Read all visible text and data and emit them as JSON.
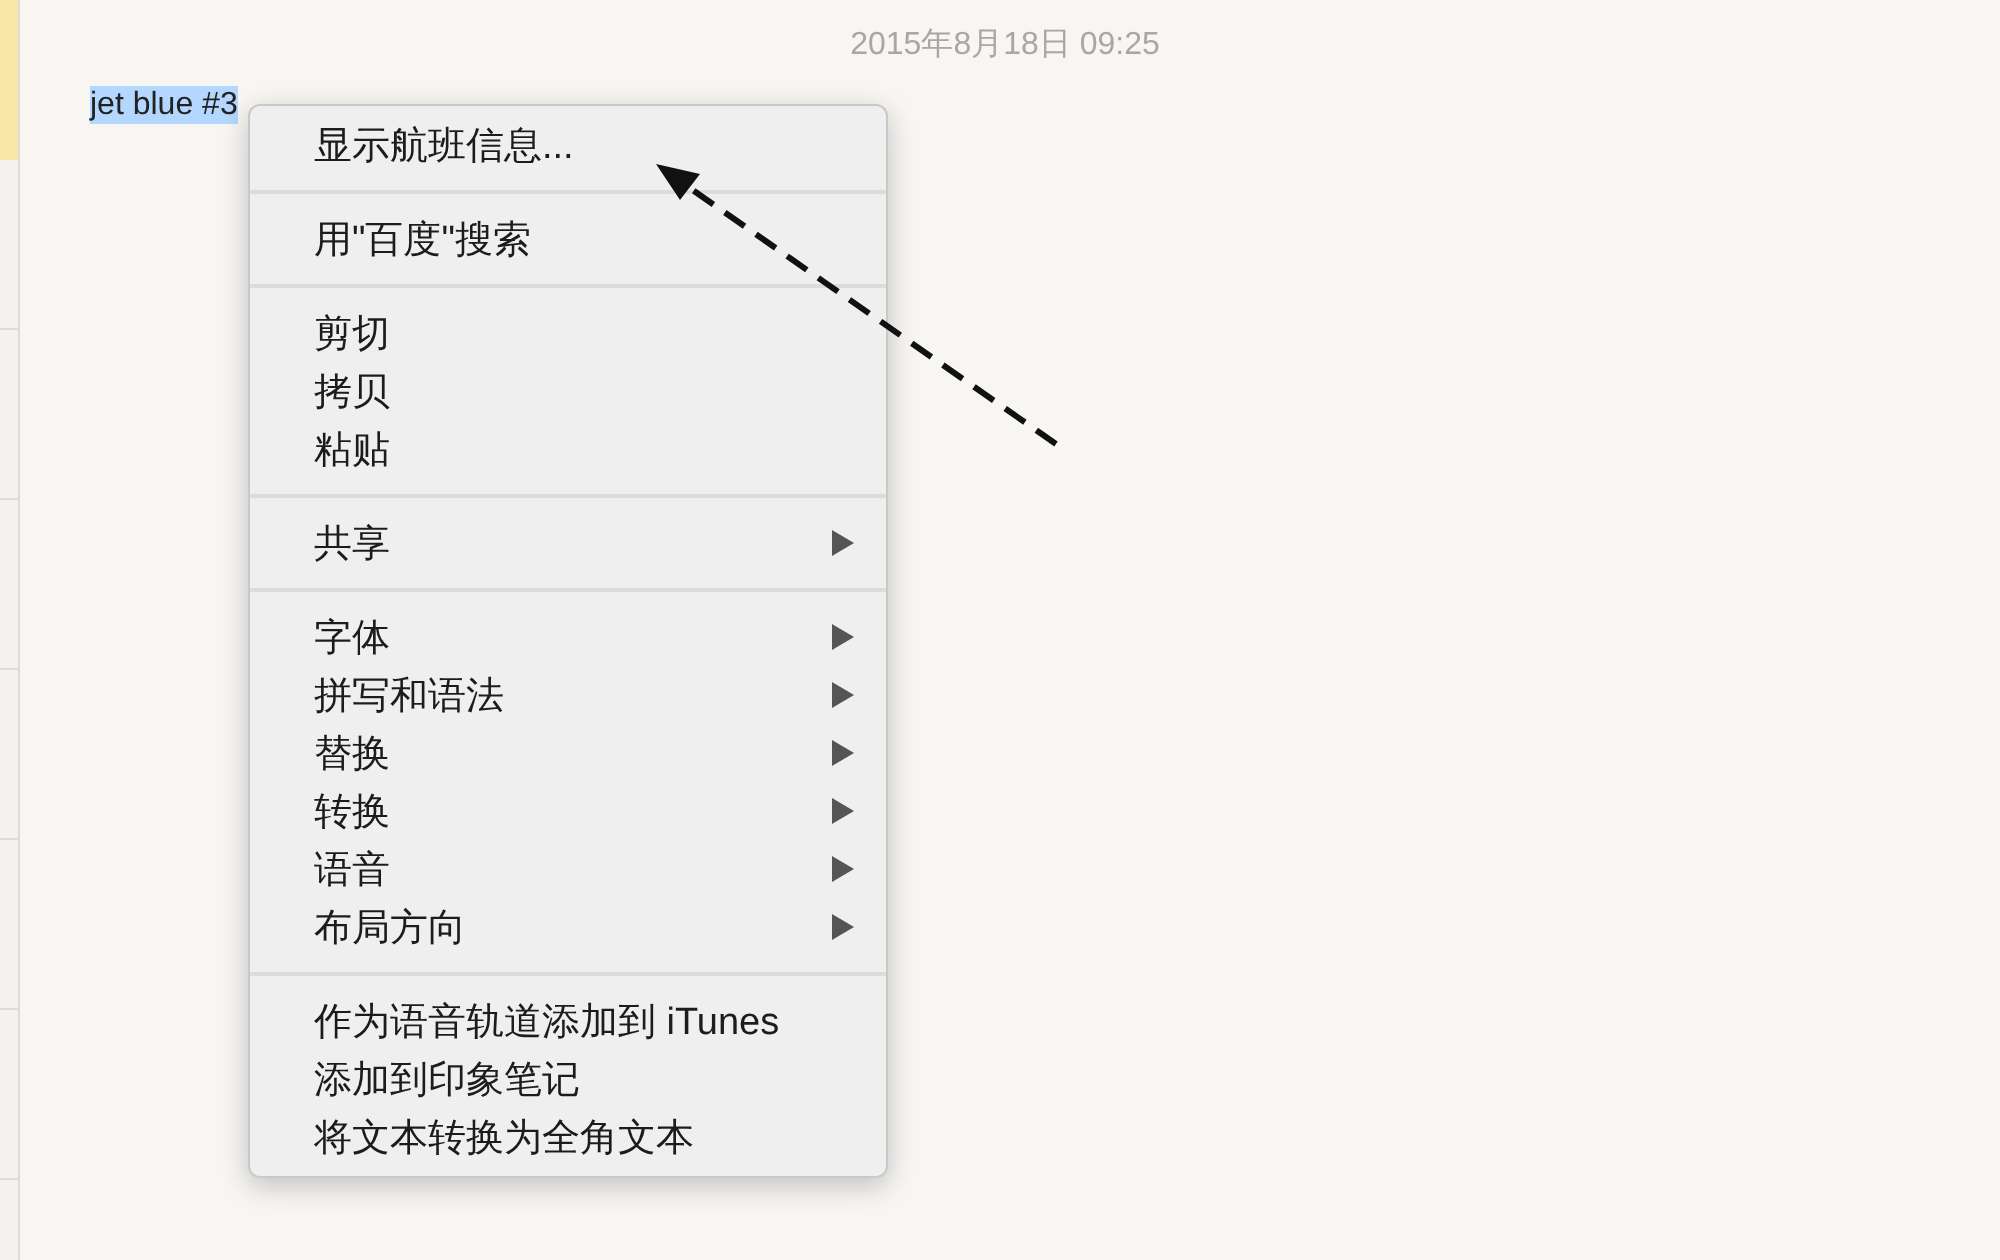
{
  "note": {
    "date": "2015年8月18日 09:25",
    "selected_text": "jet blue #3"
  },
  "context_menu": {
    "groups": [
      [
        {
          "label": "显示航班信息...",
          "submenu": false
        }
      ],
      [
        {
          "label": "用\"百度\"搜索",
          "submenu": false
        }
      ],
      [
        {
          "label": "剪切",
          "submenu": false
        },
        {
          "label": "拷贝",
          "submenu": false
        },
        {
          "label": "粘贴",
          "submenu": false
        }
      ],
      [
        {
          "label": "共享",
          "submenu": true
        }
      ],
      [
        {
          "label": "字体",
          "submenu": true
        },
        {
          "label": "拼写和语法",
          "submenu": true
        },
        {
          "label": "替换",
          "submenu": true
        },
        {
          "label": "转换",
          "submenu": true
        },
        {
          "label": "语音",
          "submenu": true
        },
        {
          "label": "布局方向",
          "submenu": true
        }
      ],
      [
        {
          "label": "作为语音轨道添加到 iTunes",
          "submenu": false
        },
        {
          "label": "添加到印象笔记",
          "submenu": false
        },
        {
          "label": "将文本转换为全角文本",
          "submenu": false
        }
      ]
    ]
  }
}
